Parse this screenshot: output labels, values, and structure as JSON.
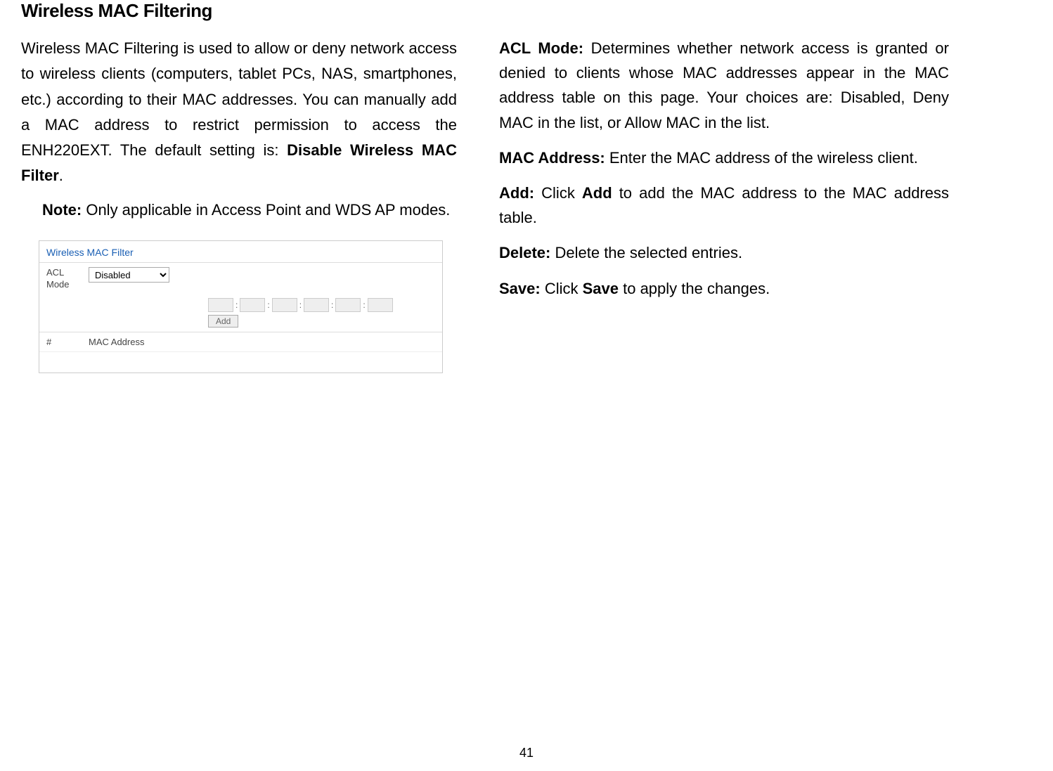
{
  "title": "Wireless MAC Filtering",
  "intro_part1": "Wireless MAC Filtering is used to allow or deny network access to wireless clients (computers, tablet PCs, NAS, smartphones, etc.) according to their MAC addresses. You can manually add a MAC address to restrict permission to access the ENH220EXT. The default setting is: ",
  "intro_bold": "Disable Wireless MAC Filter",
  "intro_end": ".",
  "note_label": "Note:",
  "note_text": "  Only applicable in Access Point and WDS AP modes.",
  "filter_box": {
    "title": "Wireless MAC Filter",
    "acl_label": "ACL Mode",
    "acl_value": "Disabled",
    "add_button": "Add",
    "col_num": "#",
    "col_mac": "MAC Address"
  },
  "defs": {
    "acl_label": "ACL Mode: ",
    "acl_text": "Determines whether network access is granted or denied to clients whose MAC addresses appear in the MAC address table on this page. Your choices are: Disabled, Deny MAC in the list, or Allow MAC in the list.",
    "mac_label": "MAC Address: ",
    "mac_text": "Enter the MAC address of the wireless client.",
    "add_label": "Add: ",
    "add_text1": "Click ",
    "add_bold": "Add",
    "add_text2": " to add the MAC address to the MAC address table.",
    "delete_label": "Delete: ",
    "delete_text": "Delete the selected entries.",
    "save_label": "Save: ",
    "save_text1": "Click ",
    "save_bold": "Save",
    "save_text2": " to apply the changes."
  },
  "page_number": "41"
}
